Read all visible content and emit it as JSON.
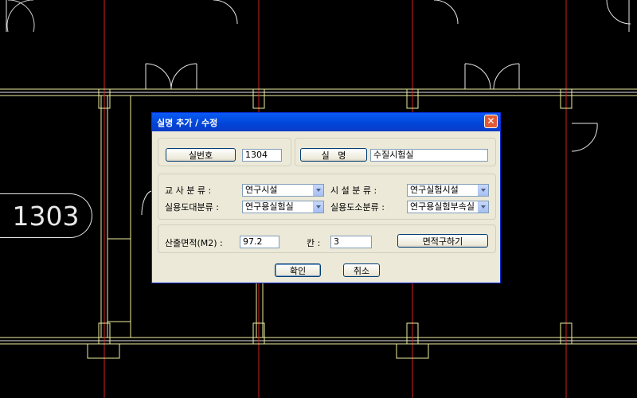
{
  "room_tag": "1303",
  "dialog": {
    "title": "실명 추가 / 수정",
    "close_glyph": "✕",
    "room_no_button": "실번호",
    "room_no_value": "1304",
    "room_name_button": "실   명",
    "room_name_value": "수질시험실",
    "school_class_label": "교 사 분 류 :",
    "school_class_value": "연구시설",
    "facility_class_label": "시 설 분 류 :",
    "facility_class_value": "연구실험시설",
    "use_major_label": "실용도대분류 :",
    "use_major_value": "연구용실험실",
    "use_minor_label": "실용도소분류 :",
    "use_minor_value": "연구용실험부속실",
    "area_label": "산출면적(M2) :",
    "area_value": "97.2",
    "bay_label": "칸 :",
    "bay_value": "3",
    "calc_area_button": "면적구하기",
    "ok_button": "확인",
    "cancel_button": "취소"
  }
}
